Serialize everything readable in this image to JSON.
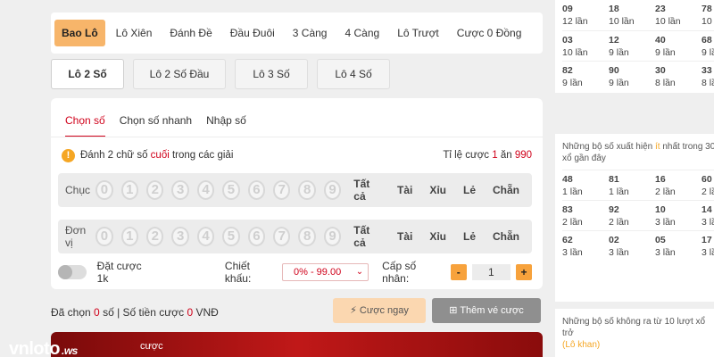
{
  "top_tabs": [
    {
      "label": "Bao Lô"
    },
    {
      "label": "Lô Xiên"
    },
    {
      "label": "Đánh Đề"
    },
    {
      "label": "Đầu Đuôi"
    },
    {
      "label": "3 Càng"
    },
    {
      "label": "4 Càng"
    },
    {
      "label": "Lô Trượt"
    },
    {
      "label": "Cược 0 Đồng"
    }
  ],
  "sub_tabs": [
    {
      "label": "Lô 2 Số"
    },
    {
      "label": "Lô 2 Số Đầu"
    },
    {
      "label": "Lô 3 Số"
    },
    {
      "label": "Lô 4 Số"
    }
  ],
  "modes": [
    {
      "label": "Chọn số"
    },
    {
      "label": "Chọn số nhanh"
    },
    {
      "label": "Nhập số"
    }
  ],
  "info": {
    "icon": "!",
    "pre": "Đánh 2 chữ số",
    "highlight": "cuối",
    "post": "trong các giải",
    "rate_label": "Tỉ lệ cược",
    "rate_a": "1",
    "rate_mid": "ăn",
    "rate_b": "990"
  },
  "rows": [
    {
      "label": "Chục",
      "digits": [
        "0",
        "1",
        "2",
        "3",
        "4",
        "5",
        "6",
        "7",
        "8",
        "9"
      ]
    },
    {
      "label": "Đơn vị",
      "digits": [
        "0",
        "1",
        "2",
        "3",
        "4",
        "5",
        "6",
        "7",
        "8",
        "9"
      ]
    }
  ],
  "quick_pick": [
    "Tất cả",
    "Tài",
    "Xỉu",
    "Lẻ",
    "Chẵn"
  ],
  "controls": {
    "toggle_label": "Đặt cược 1k",
    "discount_label": "Chiết khấu:",
    "discount_value": "0% - 99.00",
    "multiplier_label": "Cấp số nhân:",
    "minus": "-",
    "plus": "+",
    "multiplier_value": "1"
  },
  "summary": {
    "pre": "Đã chọn",
    "count": "0",
    "mid": "số | Số tiền cược",
    "amount": "0",
    "currency": "VNĐ"
  },
  "buttons": {
    "bet": "Cược ngay",
    "add": "Thêm vé cược"
  },
  "banner": {
    "text": "cược"
  },
  "logo": {
    "vn": "vn",
    "loto": "loto",
    "ws": ".ws"
  },
  "right": {
    "top_grid": [
      {
        "n": "09",
        "c": "12 lần"
      },
      {
        "n": "18",
        "c": "10 lần"
      },
      {
        "n": "23",
        "c": "10 lần"
      },
      {
        "n": "78",
        "c": "10 l"
      },
      {
        "n": "03",
        "c": "10 lần"
      },
      {
        "n": "12",
        "c": "9 lần"
      },
      {
        "n": "40",
        "c": "9 lần"
      },
      {
        "n": "68",
        "c": "9 lầ"
      },
      {
        "n": "82",
        "c": "9 lần"
      },
      {
        "n": "90",
        "c": "9 lần"
      },
      {
        "n": "30",
        "c": "8 lần"
      },
      {
        "n": "33",
        "c": "8 lầ"
      }
    ],
    "least_title_pre": "Những bộ số xuất hiện",
    "least_title_hl": "ít",
    "least_title_post": "nhất trong 30 xổ gần đây",
    "least_grid": [
      {
        "n": "48",
        "c": "1 lần"
      },
      {
        "n": "81",
        "c": "1 lần"
      },
      {
        "n": "16",
        "c": "2 lần"
      },
      {
        "n": "60",
        "c": "2 lầ"
      },
      {
        "n": "83",
        "c": "2 lần"
      },
      {
        "n": "92",
        "c": "2 lần"
      },
      {
        "n": "10",
        "c": "3 lần"
      },
      {
        "n": "14",
        "c": "3 lầ"
      },
      {
        "n": "62",
        "c": "3 lần"
      },
      {
        "n": "02",
        "c": "3 lần"
      },
      {
        "n": "05",
        "c": "3 lần"
      },
      {
        "n": "17",
        "c": "3 lầ"
      }
    ],
    "khan_title": "Những bộ số không ra từ 10 lượt xổ trở",
    "khan_hl": "(Lô khan)"
  }
}
